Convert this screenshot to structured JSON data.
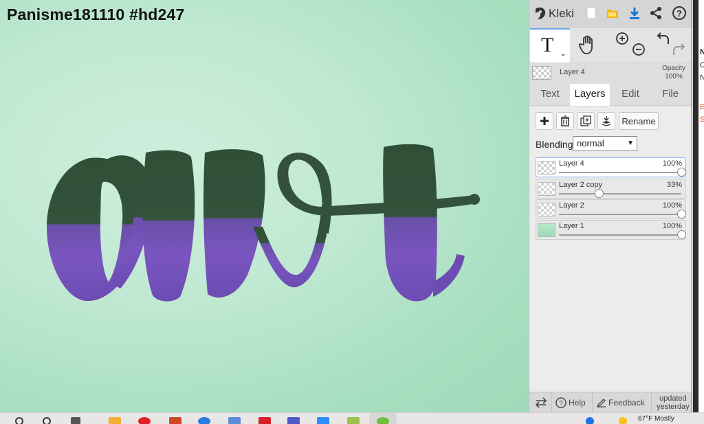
{
  "canvas": {
    "title": "Panisme181110 #hd247"
  },
  "app": {
    "name": "Kleki"
  },
  "topbar": {
    "icons": [
      "new-image-icon",
      "open-folder-icon",
      "download-icon",
      "share-icon",
      "help-icon"
    ]
  },
  "tools": {
    "active": "text",
    "text_glyph": "T",
    "caret": "⌄"
  },
  "current_layer": {
    "name": "Layer 4",
    "opacity_label": "Opacity",
    "opacity_value": "100%"
  },
  "tabs": [
    {
      "label": "Text",
      "active": false
    },
    {
      "label": "Layers",
      "active": true
    },
    {
      "label": "Edit",
      "active": false
    },
    {
      "label": "File",
      "active": false
    }
  ],
  "layer_actions": {
    "rename_label": "Rename"
  },
  "blending": {
    "label": "Blending",
    "value": "normal"
  },
  "layers": [
    {
      "name": "Layer 4",
      "opacity": "100%",
      "opacity_fraction": 1.0,
      "thumb": "transparent",
      "selected": true
    },
    {
      "name": "Layer 2 copy",
      "opacity": "33%",
      "opacity_fraction": 0.33,
      "thumb": "transparent",
      "selected": false
    },
    {
      "name": "Layer 2",
      "opacity": "100%",
      "opacity_fraction": 1.0,
      "thumb": "transparent",
      "selected": false
    },
    {
      "name": "Layer 1",
      "opacity": "100%",
      "opacity_fraction": 1.0,
      "thumb": "green",
      "selected": false
    }
  ],
  "bottombar": {
    "help_label": "Help",
    "feedback_label": "Feedback",
    "updated_line1": "updated",
    "updated_line2": "yesterday"
  },
  "background_page": {
    "letters": [
      "N",
      "C",
      "N",
      "E",
      "S"
    ]
  },
  "taskbar": {
    "time_text": "67°F  Mostly"
  }
}
